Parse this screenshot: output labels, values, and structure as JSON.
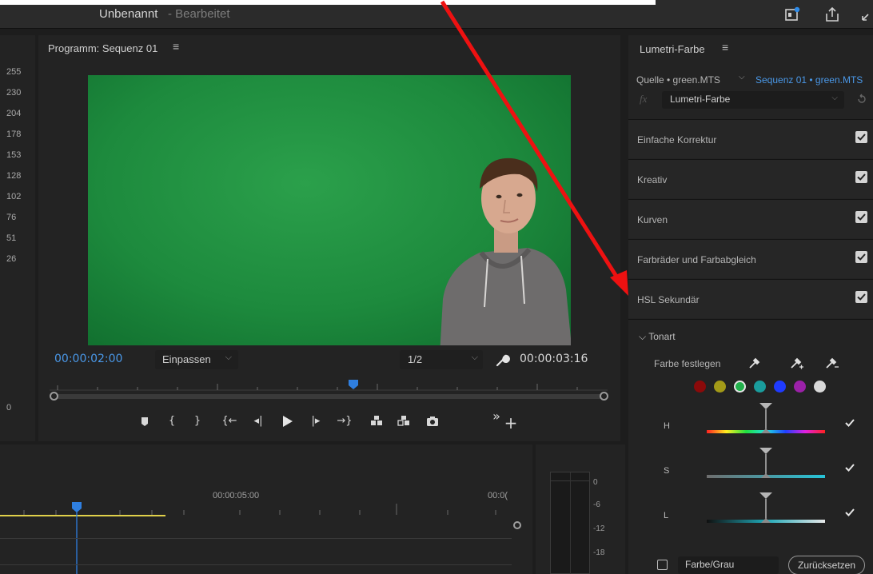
{
  "header": {
    "title": "Unbenannt",
    "status": "- Bearbeitet"
  },
  "scopes": {
    "ticks": [
      "255",
      "230",
      "204",
      "178",
      "153",
      "128",
      "102",
      "76",
      "51",
      "26",
      "0"
    ]
  },
  "program": {
    "title": "Programm: Sequenz 01",
    "menu": "≡",
    "current_timecode": "00:00:02:00",
    "fit": "Einpassen",
    "resolution": "1/2",
    "duration": "00:00:03:16"
  },
  "lumetri": {
    "title": "Lumetri-Farbe",
    "menu": "≡",
    "source": "Quelle • green.MTS",
    "sequence": "Sequenz 01 • green.MTS",
    "fx": "fx",
    "effect": "Lumetri-Farbe",
    "sections": [
      "Einfache Korrektur",
      "Kreativ",
      "Kurven",
      "Farbräder und Farbabgleich",
      "HSL Sekundär"
    ],
    "tonart": "Tonart",
    "set_color": "Farbe festlegen",
    "swatch_colors": [
      "#8b0a0a",
      "#a39a18",
      "#22b14c",
      "#1a9d9d",
      "#1f3bff",
      "#9b21a8",
      "#d9d9d9"
    ],
    "hsl_labels": [
      "H",
      "S",
      "L"
    ],
    "color_gray": "Farbe/Grau",
    "reset": "Zurücksetzen"
  },
  "timeline": {
    "time_5": "00:00:05:00",
    "time_trunc": "00:0("
  },
  "audio": {
    "levels": [
      "0",
      "-6",
      "-12",
      "-18"
    ]
  }
}
